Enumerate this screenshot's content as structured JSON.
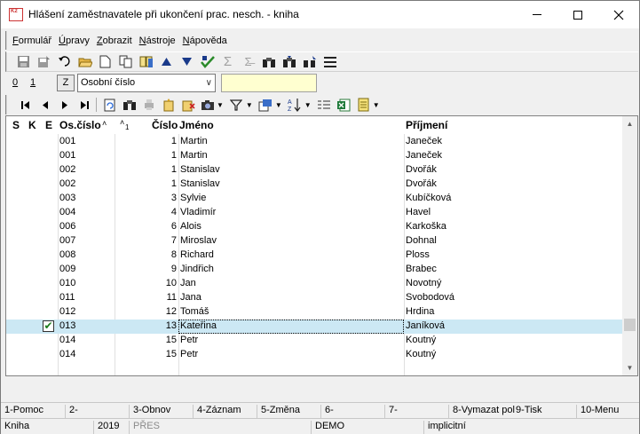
{
  "window": {
    "title": "Hlášení zaměstnavatele při ukončení prac. nesch. - kniha",
    "app_icon_text": "K2",
    "controls": {
      "minimize": "minimize-icon",
      "maximize": "maximize-icon",
      "close": "close-icon"
    }
  },
  "menu": [
    {
      "label": "Formulář",
      "accel": "F"
    },
    {
      "label": "Úpravy",
      "accel": "Ú"
    },
    {
      "label": "Zobrazit",
      "accel": "Z"
    },
    {
      "label": "Nástroje",
      "accel": "N"
    },
    {
      "label": "Nápověda",
      "accel": "N"
    }
  ],
  "toolbar_icons": [
    "save-icon",
    "save-as-icon",
    "undo-icon",
    "open-folder-icon",
    "new-document-icon",
    "copy-icon",
    "book-icon",
    "arrow-up-icon",
    "arrow-down-icon",
    "check-icon",
    "sum-icon",
    "sum-filter-icon",
    "binoculars-icon",
    "find-next-icon",
    "find-replace-icon",
    "menu-lines-icon"
  ],
  "key_row": {
    "tab0": "0",
    "tab1": "1",
    "z_button": "Z",
    "key_select": "Osobní číslo",
    "search_value": ""
  },
  "nav_icons": [
    "first-record-icon",
    "prev-record-icon",
    "next-record-icon",
    "last-record-icon",
    "refresh-icon",
    "search-icon",
    "print-icon",
    "add-record-icon",
    "delete-record-icon",
    "camera-icon",
    "filter-icon",
    "export-icon",
    "sort-icon",
    "list-icon",
    "excel-icon",
    "notes-icon"
  ],
  "grid": {
    "headers": {
      "s": "S",
      "k": "K",
      "e": "E",
      "os_cislo": "Os.číslo",
      "sort1": "˄",
      "sort2": "˄",
      "sort2_index": "1",
      "cislo": "Číslo",
      "jmeno": "Jméno",
      "prijmeni": "Příjmení"
    },
    "rows": [
      {
        "os": "001",
        "cislo": "1",
        "jmeno": "Martin",
        "prijmeni": "Janeček",
        "checked": false
      },
      {
        "os": "001",
        "cislo": "1",
        "jmeno": "Martin",
        "prijmeni": "Janeček",
        "checked": false
      },
      {
        "os": "002",
        "cislo": "1",
        "jmeno": "Stanislav",
        "prijmeni": "Dvořák",
        "checked": false
      },
      {
        "os": "002",
        "cislo": "1",
        "jmeno": "Stanislav",
        "prijmeni": "Dvořák",
        "checked": false
      },
      {
        "os": "003",
        "cislo": "3",
        "jmeno": "Sylvie",
        "prijmeni": "Kubíčková",
        "checked": false
      },
      {
        "os": "004",
        "cislo": "4",
        "jmeno": "Vladimír",
        "prijmeni": "Havel",
        "checked": false
      },
      {
        "os": "006",
        "cislo": "6",
        "jmeno": "Alois",
        "prijmeni": "Karkoška",
        "checked": false
      },
      {
        "os": "007",
        "cislo": "7",
        "jmeno": "Miroslav",
        "prijmeni": "Dohnal",
        "checked": false
      },
      {
        "os": "008",
        "cislo": "8",
        "jmeno": "Richard",
        "prijmeni": "Ploss",
        "checked": false
      },
      {
        "os": "009",
        "cislo": "9",
        "jmeno": "Jindřich",
        "prijmeni": "Brabec",
        "checked": false
      },
      {
        "os": "010",
        "cislo": "10",
        "jmeno": "Jan",
        "prijmeni": "Novotný",
        "checked": false
      },
      {
        "os": "011",
        "cislo": "11",
        "jmeno": "Jana",
        "prijmeni": "Svobodová",
        "checked": false
      },
      {
        "os": "012",
        "cislo": "12",
        "jmeno": "Tomáš",
        "prijmeni": "Hrdina",
        "checked": false
      },
      {
        "os": "013",
        "cislo": "13",
        "jmeno": "Kateřina",
        "prijmeni": "Janíková",
        "checked": true,
        "selected": true
      },
      {
        "os": "014",
        "cislo": "15",
        "jmeno": "Petr",
        "prijmeni": "Koutný",
        "checked": false
      },
      {
        "os": "014",
        "cislo": "15",
        "jmeno": "Petr",
        "prijmeni": "Koutný",
        "checked": false
      }
    ]
  },
  "function_keys": [
    "1-Pomoc",
    "2-",
    "3-Obnov",
    "4-Záznam",
    "5-Změna",
    "6-",
    "7-",
    "8-Vymazat pol",
    "9-Tisk",
    "10-Menu"
  ],
  "status_bar": {
    "book": "Kniha",
    "year": "2019",
    "mode": "PŘES",
    "database": "DEMO",
    "setting": "implicitní"
  },
  "colors": {
    "selected_row": "#cce8f4",
    "key_input_bg": "#ffffd0",
    "check_color": "#1a7a1a"
  }
}
